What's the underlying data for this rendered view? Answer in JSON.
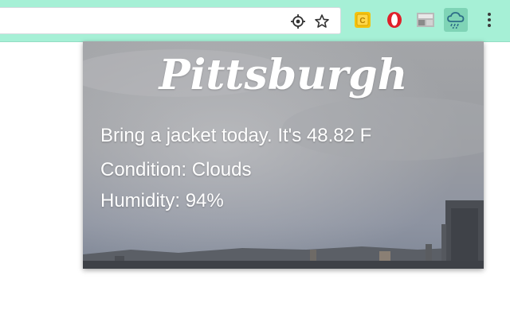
{
  "toolbar": {
    "bg_color": "#a6f0d6",
    "omnibox_icons": [
      "target-icon",
      "star-icon"
    ],
    "extensions": [
      {
        "name": "yellow-extension-icon",
        "letter": "C",
        "color": "#f4c20d"
      },
      {
        "name": "opera-vpn-icon",
        "color": "#e0202a"
      },
      {
        "name": "image-extension-icon"
      },
      {
        "name": "weather-cloud-rain-icon",
        "active": true
      }
    ]
  },
  "popup": {
    "city": "Pittsburgh",
    "message": "Bring a jacket today. It's 48.82 F",
    "condition": "Condition: Clouds",
    "humidity": "Humidity: 94%"
  }
}
